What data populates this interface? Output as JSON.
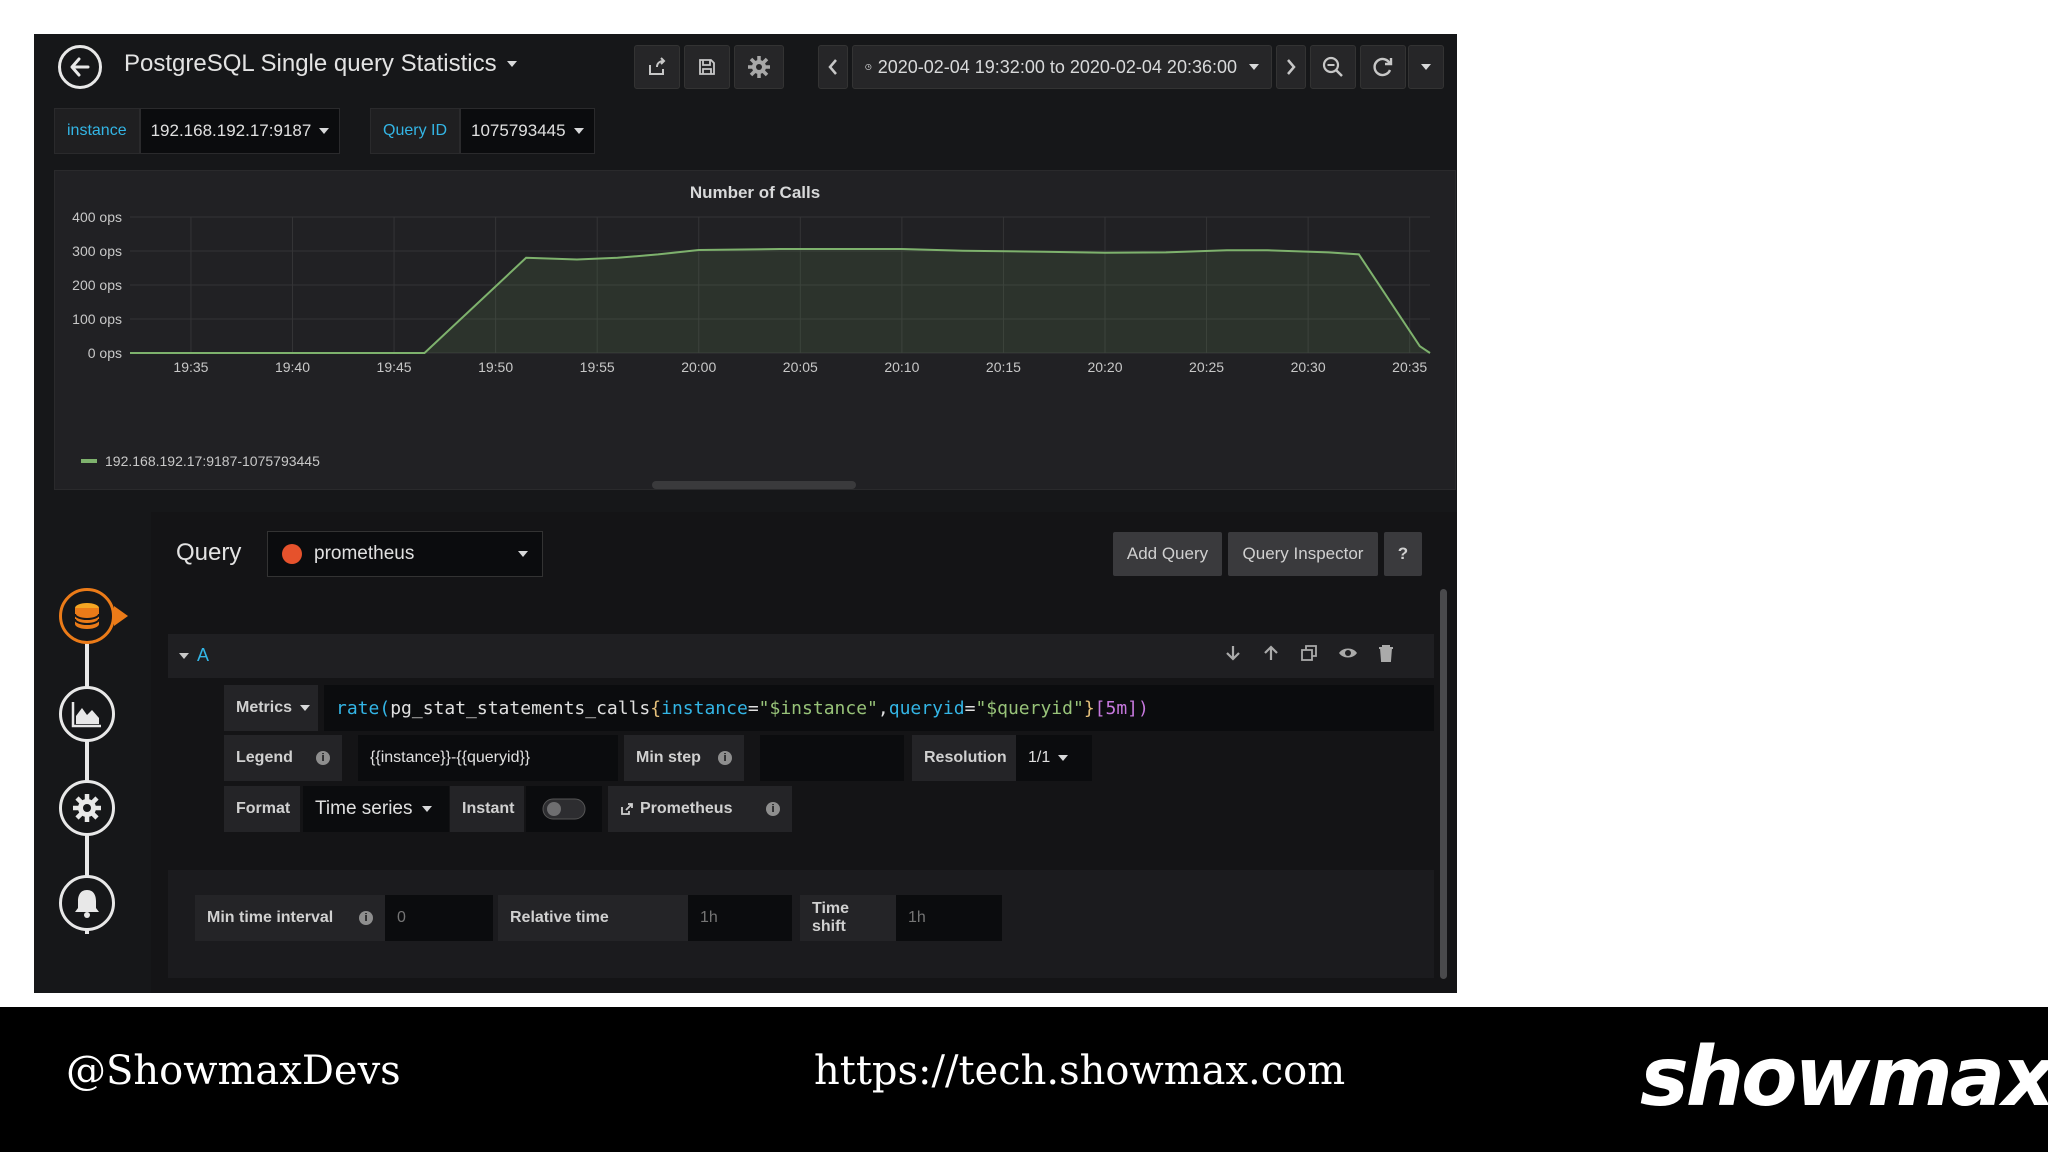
{
  "dashboard": {
    "title": "PostgreSQL Single query Statistics",
    "time_range": "2020-02-04 19:32:00 to 2020-02-04 20:36:00"
  },
  "variables": [
    {
      "label": "instance",
      "value": "192.168.192.17:9187"
    },
    {
      "label": "Query ID",
      "value": "1075793445"
    }
  ],
  "icons": {
    "back": "arrow-left-icon",
    "share": "share-icon",
    "save": "save-icon",
    "settings": "gear-icon",
    "prev": "chevron-left-icon",
    "clock": "clock-icon",
    "next": "chevron-right-icon",
    "zoom": "zoom-out-icon",
    "refresh": "refresh-icon"
  },
  "panel": {
    "title": "Number of Calls"
  },
  "chart_data": {
    "type": "area",
    "title": "Number of Calls",
    "x_ticks": [
      "19:35",
      "19:40",
      "19:45",
      "19:50",
      "19:55",
      "20:00",
      "20:05",
      "20:10",
      "20:15",
      "20:20",
      "20:25",
      "20:30",
      "20:35"
    ],
    "y_ticks": [
      "0 ops",
      "100 ops",
      "200 ops",
      "300 ops",
      "400 ops"
    ],
    "ylim": [
      0,
      400
    ],
    "xlim": [
      "19:32",
      "20:36"
    ],
    "unit": "ops",
    "grid": true,
    "legend_position": "bottom-left",
    "series": [
      {
        "name": "192.168.192.17:9187-1075793445",
        "color": "#7eb26d",
        "points": [
          [
            "19:32",
            0
          ],
          [
            "19:46.5",
            0
          ],
          [
            "19:51.5",
            280
          ],
          [
            "19:54",
            275
          ],
          [
            "19:56",
            280
          ],
          [
            "19:58",
            290
          ],
          [
            "20:00",
            303
          ],
          [
            "20:04",
            306
          ],
          [
            "20:10",
            306
          ],
          [
            "20:13",
            301
          ],
          [
            "20:17",
            298
          ],
          [
            "20:20",
            295
          ],
          [
            "20:23",
            296
          ],
          [
            "20:26",
            302
          ],
          [
            "20:28",
            302
          ],
          [
            "20:31",
            296
          ],
          [
            "20:32.5",
            290
          ],
          [
            "20:35.5",
            20
          ],
          [
            "20:36",
            0
          ]
        ]
      }
    ]
  },
  "query_editor": {
    "section_title": "Query",
    "datasource": "prometheus",
    "add_query": "Add Query",
    "query_inspector": "Query Inspector",
    "help": "?",
    "row_name": "A",
    "metrics_label": "Metrics",
    "expr": {
      "fn": "rate(",
      "metric": "pg_stat_statements_calls",
      "brace_open": "{",
      "l1_key": "instance",
      "eq1": "=",
      "l1_val": "\"$instance\"",
      "comma": ", ",
      "l2_key": "queryid",
      "eq2": "=",
      "l2_val": "\"$queryid\"",
      "brace_close": "}",
      "range": "[5m]",
      "paren_close": ")"
    },
    "legend_label": "Legend",
    "legend_value": "{{instance}}-{{queryid}}",
    "min_step_label": "Min step",
    "min_step_value": "",
    "resolution_label": "Resolution",
    "resolution_value": "1/1",
    "format_label": "Format",
    "format_value": "Time series",
    "instant_label": "Instant",
    "instant_on": false,
    "prometheus_link": "Prometheus",
    "min_interval_label": "Min time interval",
    "min_interval_placeholder": "0",
    "relative_time_label": "Relative time",
    "relative_time_placeholder": "1h",
    "time_shift_label": "Time shift",
    "time_shift_placeholder": "1h"
  },
  "footer": {
    "handle": "@ShowmaxDevs",
    "url": "https://tech.showmax.com",
    "logo": "showmax"
  }
}
